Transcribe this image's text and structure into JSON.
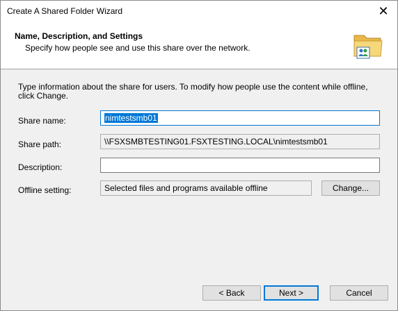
{
  "window": {
    "title": "Create A Shared Folder Wizard"
  },
  "header": {
    "title": "Name, Description, and Settings",
    "subtitle": "Specify how people see and use this share over the network."
  },
  "intro": "Type information about the share for users. To modify how people use the content while offline, click Change.",
  "form": {
    "share_name_label": "Share name:",
    "share_name_value": "nimtestsmb01",
    "share_path_label": "Share path:",
    "share_path_value": "\\\\FSXSMBTESTING01.FSXTESTING.LOCAL\\nimtestsmb01",
    "description_label": "Description:",
    "description_value": "",
    "offline_label": "Offline setting:",
    "offline_value": "Selected files and programs available offline",
    "change_button": "Change..."
  },
  "buttons": {
    "back": "< Back",
    "next": "Next >",
    "cancel": "Cancel"
  },
  "colors": {
    "accent": "#0078d7"
  }
}
